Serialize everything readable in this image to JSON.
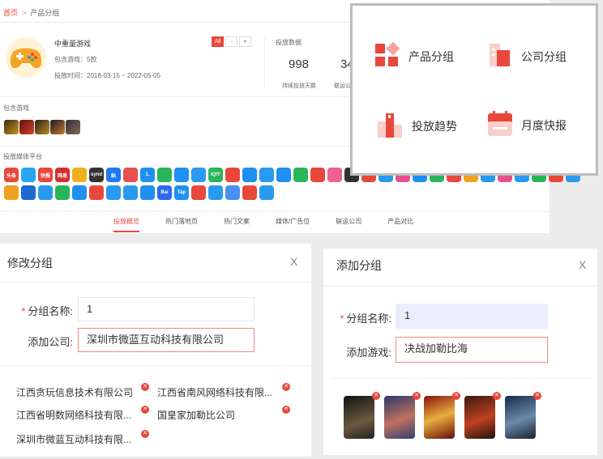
{
  "breadcrumb": {
    "home": "首页",
    "separator": ">",
    "current": "产品分组"
  },
  "game": {
    "name": "中重量游戏",
    "included_games": "包含游戏：5款",
    "date_range": "投放时间：2018-03-15 ~ 2022-05-05",
    "filters": [
      "All",
      "",
      ""
    ]
  },
  "stats": {
    "title": "投放数据",
    "items": [
      {
        "value": "998",
        "label": "持续投放天数"
      },
      {
        "value": "34",
        "label": "联运公"
      }
    ]
  },
  "sections": {
    "games_label": "包含游戏",
    "media_label": "投放媒体平台"
  },
  "media_icons_row1": [
    "头条",
    "",
    "快报",
    "网易",
    "",
    "synd",
    "贴",
    "",
    "1.",
    "",
    "",
    "",
    "iQIY",
    "",
    "",
    "",
    "",
    "",
    "",
    "",
    "",
    "",
    "",
    "",
    "",
    "",
    "",
    "",
    "",
    "",
    "",
    "",
    "",
    ""
  ],
  "media_icons_row2": [
    "",
    "",
    "",
    "",
    "",
    "",
    "",
    "",
    "",
    "Bai",
    "Tap",
    "",
    "",
    "",
    "",
    ""
  ],
  "tabs": [
    "投放概览",
    "热门落地页",
    "热门文案",
    "媒体/广告位",
    "联运公司",
    "产品对比"
  ],
  "nav_menu": [
    {
      "label": "产品分组",
      "icon": "grid-icon"
    },
    {
      "label": "公司分组",
      "icon": "building-icon"
    },
    {
      "label": "投放趋势",
      "icon": "chart-icon"
    },
    {
      "label": "月度快报",
      "icon": "calendar-icon"
    }
  ],
  "modify_modal": {
    "title": "修改分组",
    "close": "X",
    "name_label": "分组名称:",
    "name_value": "1",
    "company_label": "添加公司:",
    "company_value": "深圳市微蓝互动科技有限公司",
    "companies": [
      "江西贪玩信息技术有限公司",
      "江西省南风网络科技有限...",
      "江西省明数网络科技有限...",
      "国皇家加勒比公司",
      "深圳市微蓝互动科技有限..."
    ]
  },
  "add_modal": {
    "title": "添加分组",
    "close": "X",
    "name_label": "分组名称:",
    "name_value": "1",
    "game_label": "添加游戏:",
    "game_value": "决战加勒比海"
  },
  "colors": {
    "accent": "#e8483b",
    "accent_light": "#f5a59d"
  }
}
